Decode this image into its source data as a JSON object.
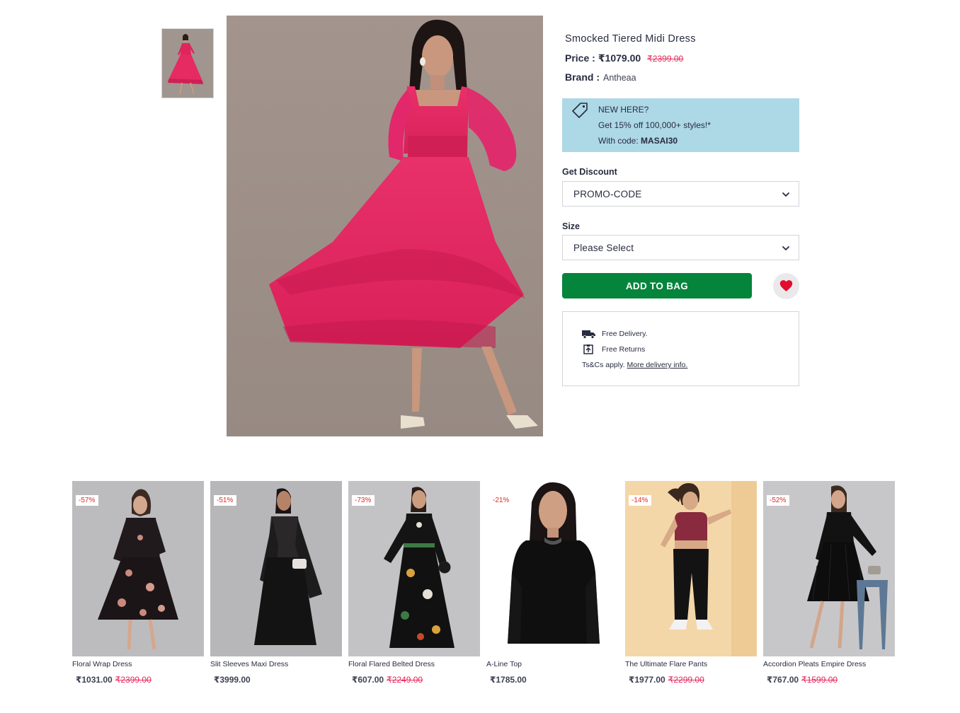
{
  "product": {
    "title": "Smocked Tiered Midi Dress",
    "price_label": "Price :",
    "price": "₹1079.00",
    "mrp": "₹2399.00",
    "brand_label": "Brand :",
    "brand": "Antheaa"
  },
  "promo": {
    "line1": "NEW HERE?",
    "line2": "Get 15% off 100,000+ styles!*",
    "line3_prefix": "With code: ",
    "code": "MASAI30",
    "background_color": "#add8e6"
  },
  "discount": {
    "label": "Get Discount",
    "selected": "PROMO-CODE"
  },
  "size": {
    "label": "Size",
    "selected": "Please Select"
  },
  "actions": {
    "add_to_bag": "ADD TO BAG",
    "add_to_bag_color": "#05843c",
    "wishlist_icon": "heart-icon"
  },
  "delivery": {
    "free_delivery": "Free Delivery.",
    "free_returns": "Free Returns",
    "terms_prefix": "Ts&Cs apply.",
    "terms_link": "More delivery info."
  },
  "recommendations": [
    {
      "name": "Floral Wrap Dress",
      "discount": "-57%",
      "price": "₹1031.00",
      "mrp": "₹2399.00"
    },
    {
      "name": "Slit Sleeves Maxi Dress",
      "discount": "-51%",
      "price": "₹3999.00",
      "mrp": ""
    },
    {
      "name": "Floral Flared Belted Dress",
      "discount": "-73%",
      "price": "₹607.00",
      "mrp": "₹2249.00"
    },
    {
      "name": "A-Line Top",
      "discount": "-21%",
      "price": "₹1785.00",
      "mrp": ""
    },
    {
      "name": "The Ultimate Flare Pants",
      "discount": "-14%",
      "price": "₹1977.00",
      "mrp": "₹2299.00"
    },
    {
      "name": "Accordion Pleats Empire Dress",
      "discount": "-52%",
      "price": "₹767.00",
      "mrp": "₹1599.00"
    }
  ]
}
